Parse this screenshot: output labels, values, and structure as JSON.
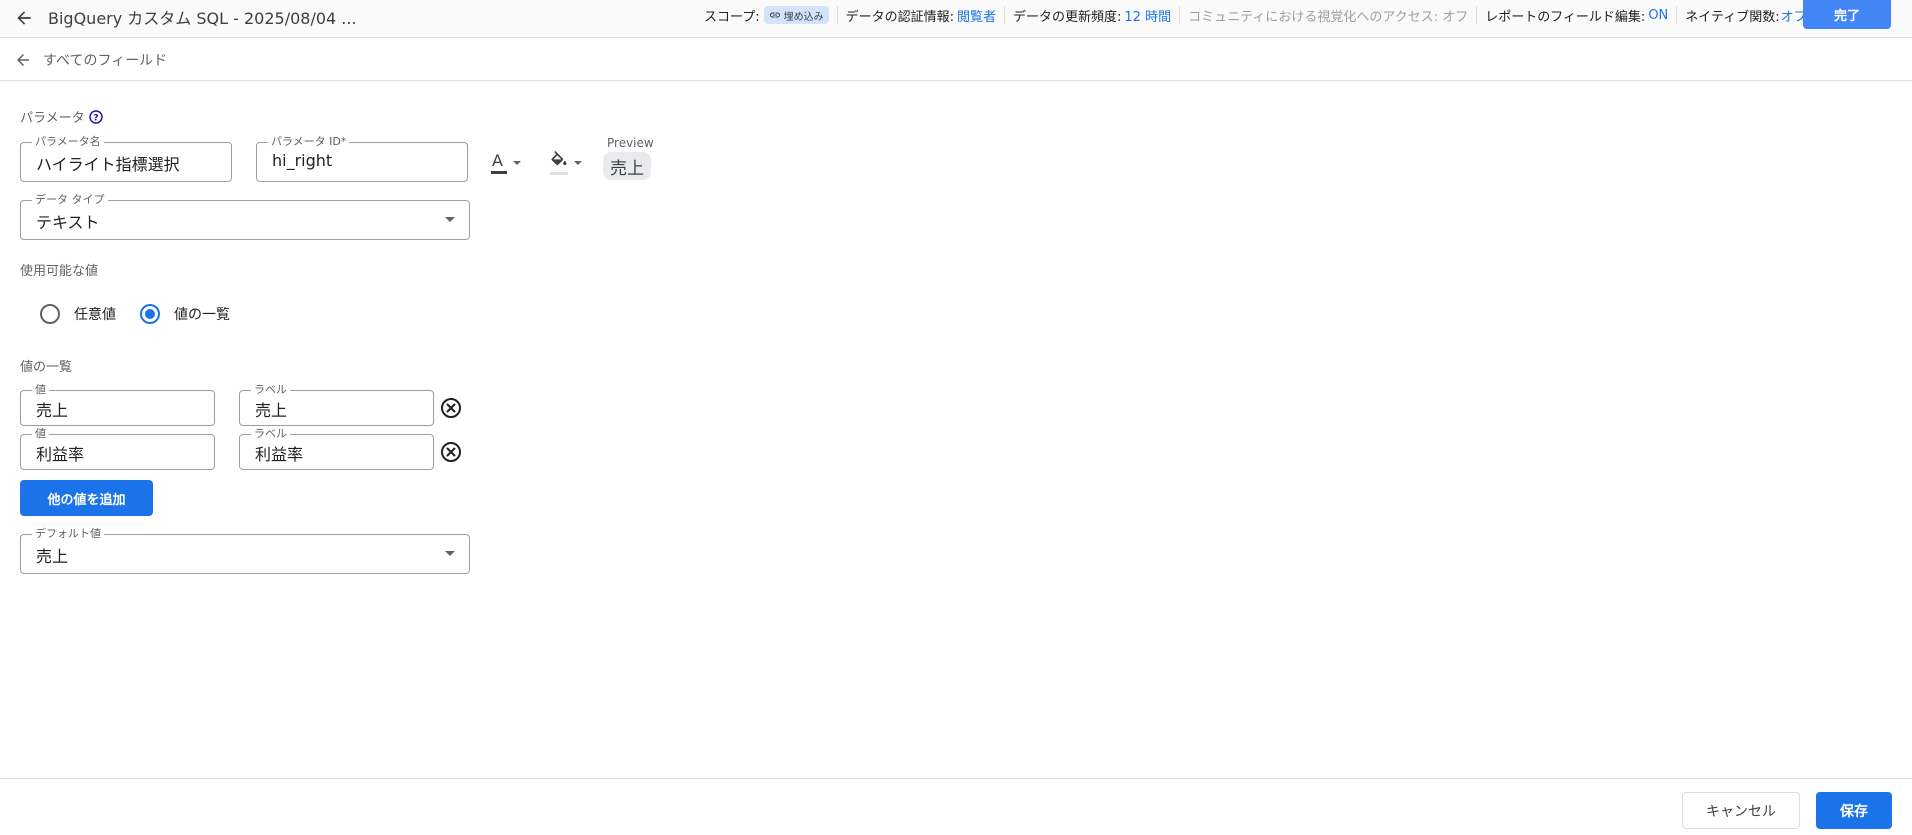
{
  "header": {
    "title": "BigQuery カスタム SQL - 2025/08/04 ...",
    "scope_label": "スコープ:",
    "scope_chip": "埋め込み",
    "credentials_label": "データの認証情報:",
    "credentials_value": "閲覧者",
    "freshness_label": "データの更新頻度:",
    "freshness_value": "12 時間",
    "community_access": "コミュニティにおける視覚化へのアクセス: オフ",
    "field_edit_label": "レポートのフィールド編集:",
    "field_edit_value": "ON",
    "native_label": "ネイティブ関数:",
    "native_value": "オフ",
    "done_label": "完了"
  },
  "subheader": {
    "title": "すべてのフィールド"
  },
  "form": {
    "section_title": "パラメータ",
    "param_name_label": "パラメータ名",
    "param_name_value": "ハイライト指標選択",
    "param_id_label": "パラメータ ID*",
    "param_id_value": "hi_right",
    "text_color_glyph": "A",
    "preview_label": "Preview",
    "preview_value": "売上",
    "data_type_label": "データ タイプ",
    "data_type_value": "テキスト",
    "available_values_title": "使用可能な値",
    "radio_any": "任意値",
    "radio_list": "値の一覧",
    "value_list_title": "値の一覧",
    "value_rows": [
      {
        "value_label": "値",
        "value": "売上",
        "label_label": "ラベル",
        "label": "売上"
      },
      {
        "value_label": "値",
        "value": "利益率",
        "label_label": "ラベル",
        "label": "利益率"
      }
    ],
    "add_button": "他の値を追加",
    "default_label": "デフォルト値",
    "default_value": "売上"
  },
  "footer": {
    "cancel": "キャンセル",
    "save": "保存"
  },
  "colors": {
    "accent": "#1a73e8",
    "done_button": "#4285f4",
    "chip": "#d2e3fc"
  }
}
